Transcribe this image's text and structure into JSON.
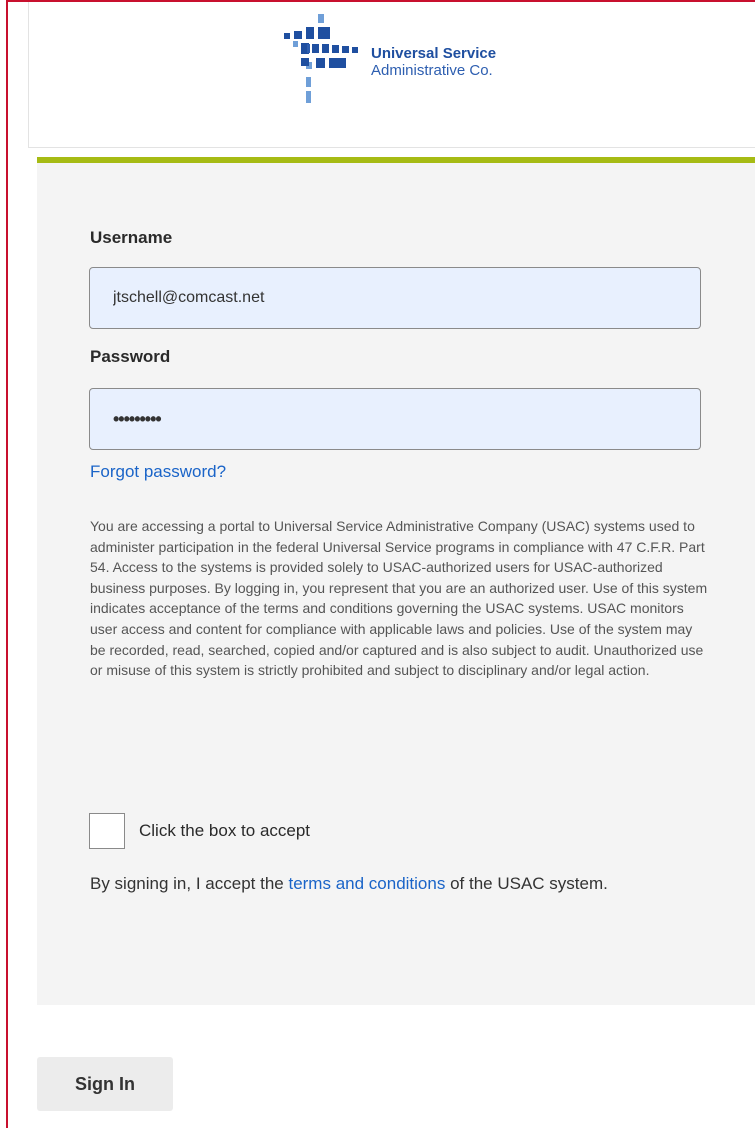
{
  "brand": {
    "name_line1": "Universal Service",
    "name_line2": "Administrative Co.",
    "primary_color": "#1f4fa0",
    "accent_color": "#a6bb14",
    "link_color": "#1a64c8",
    "frame_color": "#c8102e"
  },
  "form": {
    "username_label": "Username",
    "username_value": "jtschell@comcast.net",
    "password_label": "Password",
    "password_value": "*********",
    "forgot_password": "Forgot password?",
    "disclaimer": "You are accessing a portal to Universal Service Administrative Company (USAC) systems used to administer participation in the federal Universal Service programs in compliance with 47 C.F.R. Part 54. Access to the systems is provided solely to USAC-authorized users for USAC-authorized business purposes. By logging in, you represent that you are an authorized user. Use of this system indicates acceptance of the terms and conditions governing the USAC systems. USAC monitors user access and content for compliance with applicable laws and policies. Use of the system may be recorded, read, searched, copied and/or captured and is also subject to audit. Unauthorized use or misuse of this system is strictly prohibited and subject to disciplinary and/or legal action.",
    "checkbox_label": "Click the box to accept",
    "checkbox_checked": false,
    "accept_prefix": "By signing in, I accept the",
    "accept_link": "terms and conditions",
    "accept_suffix": "of the USAC system."
  },
  "actions": {
    "sign_in": "Sign In"
  }
}
